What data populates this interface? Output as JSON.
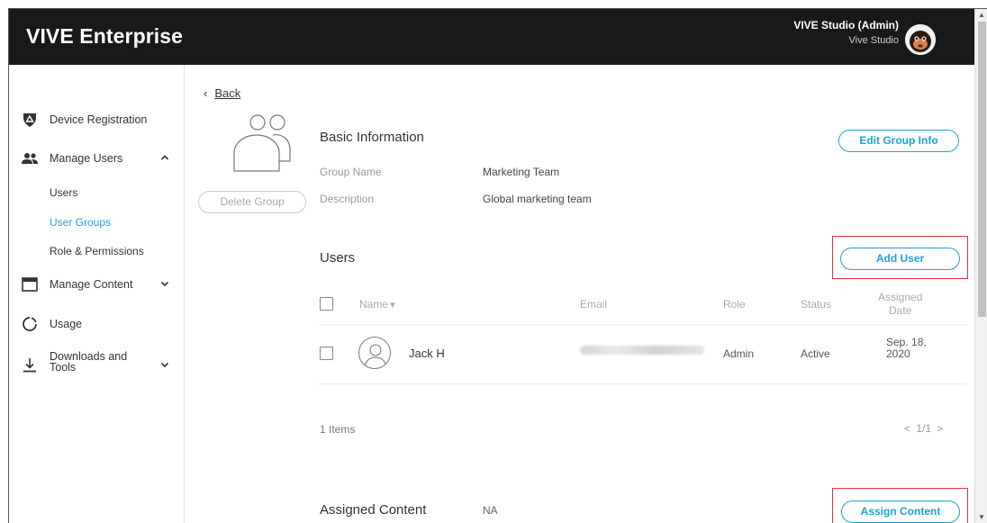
{
  "header": {
    "brand": "VIVE Enterprise",
    "user_name": "VIVE Studio (Admin)",
    "user_org": "Vive Studio"
  },
  "sidebar": {
    "items": [
      {
        "label": "Device Registration",
        "icon": "shield-icon"
      },
      {
        "label": "Manage Users",
        "icon": "users-icon",
        "expanded": true,
        "children": [
          "Users",
          "User Groups",
          "Role & Permissions"
        ]
      },
      {
        "label": "Manage Content",
        "icon": "window-icon",
        "expanded": false
      },
      {
        "label": "Usage",
        "icon": "usage-ring-icon"
      },
      {
        "label_line1": "Downloads and",
        "label_line2": "Tools",
        "icon": "download-icon",
        "expanded": false
      }
    ],
    "active_child": "User Groups"
  },
  "main": {
    "back_label": "Back",
    "delete_group_label": "Delete Group",
    "basic_info": {
      "title": "Basic Information",
      "edit_label": "Edit Group Info",
      "group_name_label": "Group Name",
      "group_name_value": "Marketing Team",
      "description_label": "Description",
      "description_value": "Global marketing team"
    },
    "users": {
      "title": "Users",
      "add_label": "Add User",
      "columns": {
        "name": "Name",
        "email": "Email",
        "role": "Role",
        "status": "Status",
        "assigned_line1": "Assigned",
        "assigned_line2": "Date"
      },
      "rows": [
        {
          "name": "Jack H",
          "role": "Admin",
          "status": "Active",
          "date_line1": "Sep. 18,",
          "date_line2": "2020"
        }
      ],
      "items_count": "1 Items",
      "pager": "< 1/1 >"
    },
    "assigned_content": {
      "title": "Assigned Content",
      "value": "NA",
      "assign_label": "Assign Content"
    }
  },
  "colors": {
    "header_bg": "#18191b",
    "accent": "#1ea2d8",
    "highlight_box": "#e0343b"
  }
}
